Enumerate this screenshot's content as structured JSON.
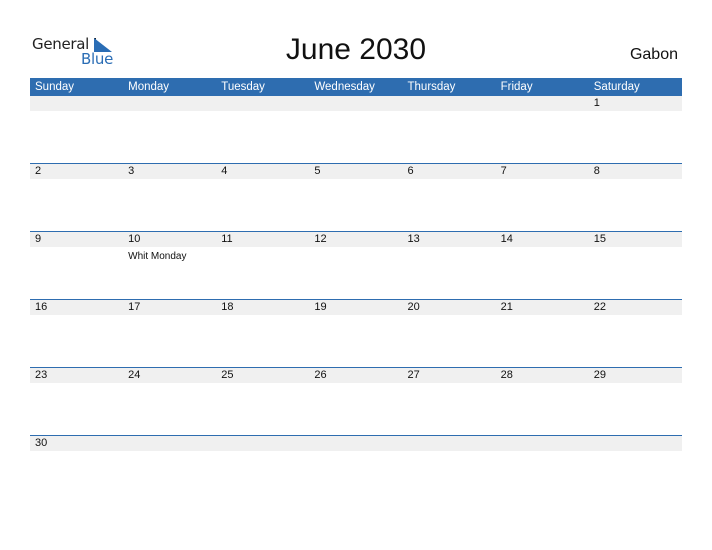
{
  "logo": {
    "general": "General",
    "blue": "Blue"
  },
  "title": "June 2030",
  "country": "Gabon",
  "colors": {
    "accent": "#2e6db0",
    "day_row_bg": "#f0f0f0"
  },
  "weekdays": [
    "Sunday",
    "Monday",
    "Tuesday",
    "Wednesday",
    "Thursday",
    "Friday",
    "Saturday"
  ],
  "weeks": [
    [
      {
        "day": ""
      },
      {
        "day": ""
      },
      {
        "day": ""
      },
      {
        "day": ""
      },
      {
        "day": ""
      },
      {
        "day": ""
      },
      {
        "day": "1"
      }
    ],
    [
      {
        "day": "2"
      },
      {
        "day": "3"
      },
      {
        "day": "4"
      },
      {
        "day": "5"
      },
      {
        "day": "6"
      },
      {
        "day": "7"
      },
      {
        "day": "8"
      }
    ],
    [
      {
        "day": "9"
      },
      {
        "day": "10",
        "holiday": "Whit Monday"
      },
      {
        "day": "11"
      },
      {
        "day": "12"
      },
      {
        "day": "13"
      },
      {
        "day": "14"
      },
      {
        "day": "15"
      }
    ],
    [
      {
        "day": "16"
      },
      {
        "day": "17"
      },
      {
        "day": "18"
      },
      {
        "day": "19"
      },
      {
        "day": "20"
      },
      {
        "day": "21"
      },
      {
        "day": "22"
      }
    ],
    [
      {
        "day": "23"
      },
      {
        "day": "24"
      },
      {
        "day": "25"
      },
      {
        "day": "26"
      },
      {
        "day": "27"
      },
      {
        "day": "28"
      },
      {
        "day": "29"
      }
    ],
    [
      {
        "day": "30"
      },
      {
        "day": ""
      },
      {
        "day": ""
      },
      {
        "day": ""
      },
      {
        "day": ""
      },
      {
        "day": ""
      },
      {
        "day": ""
      }
    ]
  ]
}
